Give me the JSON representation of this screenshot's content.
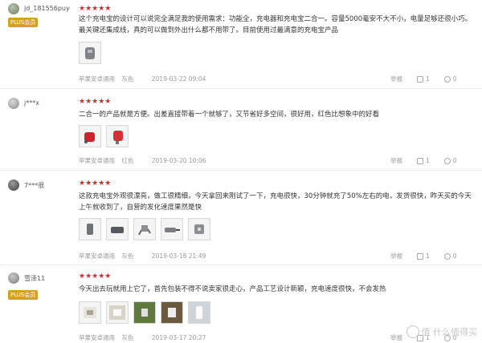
{
  "reviews": [
    {
      "username": "jd_181556puy",
      "badge": "PLUS会员",
      "stars": "★★★★★",
      "text": "这个充电宝的设计可以说完全满足我的使用需求：功能全，充电器和充电宝二合一。容量5000毫安不大不小，电量足够还很小巧。最关键还集成线，真的可以做到外出什么都不用带了。目前使用过最满意的充电宝产品",
      "product": "苹果安卓通用",
      "color": "灰色",
      "date": "2019-03-22 09:04",
      "report": "举报",
      "likes": "1",
      "comments": "0"
    },
    {
      "username": "j***x",
      "badge": "",
      "stars": "★★★★★",
      "text": "二合一的产品就是方便。出差直接带着一个就够了，又节省好多空间，很好用，红色比想象中的好看",
      "product": "苹果安卓通用",
      "color": "红色",
      "date": "2019-03-20 10:06",
      "report": "举报",
      "likes": "1",
      "comments": "0"
    },
    {
      "username": "7***很",
      "badge": "",
      "stars": "★★★★★",
      "text": "这款充电宝外观很漂亮，做工很精细，今天拿回来刚试了一下，充电很快，30分钟就充了50%左右的电，发货很快，昨天买的今天上午就收到了，自营的发化速度果然是快",
      "product": "苹果安卓通用",
      "color": "灰色",
      "date": "2019-03-18 21:49",
      "report": "举报",
      "likes": "1",
      "comments": "0"
    },
    {
      "username": "雪泽11",
      "badge": "PLUS会员",
      "stars": "★★★★★",
      "text": "今天出去玩就用上它了，首先包装不得不说卖家很走心，产品工艺设计新颖，充电速度很快，不会发热",
      "product": "苹果安卓通用",
      "color": "灰色",
      "date": "2019-03-17 20:27",
      "report": "举报",
      "likes": "1",
      "comments": "0"
    }
  ],
  "watermark": "值 什么值得买",
  "thumb_colors": {
    "gray": "#8a8d91",
    "red": "#d0282e",
    "brown": "#6b5a3e",
    "green": "#5f7a3c"
  }
}
